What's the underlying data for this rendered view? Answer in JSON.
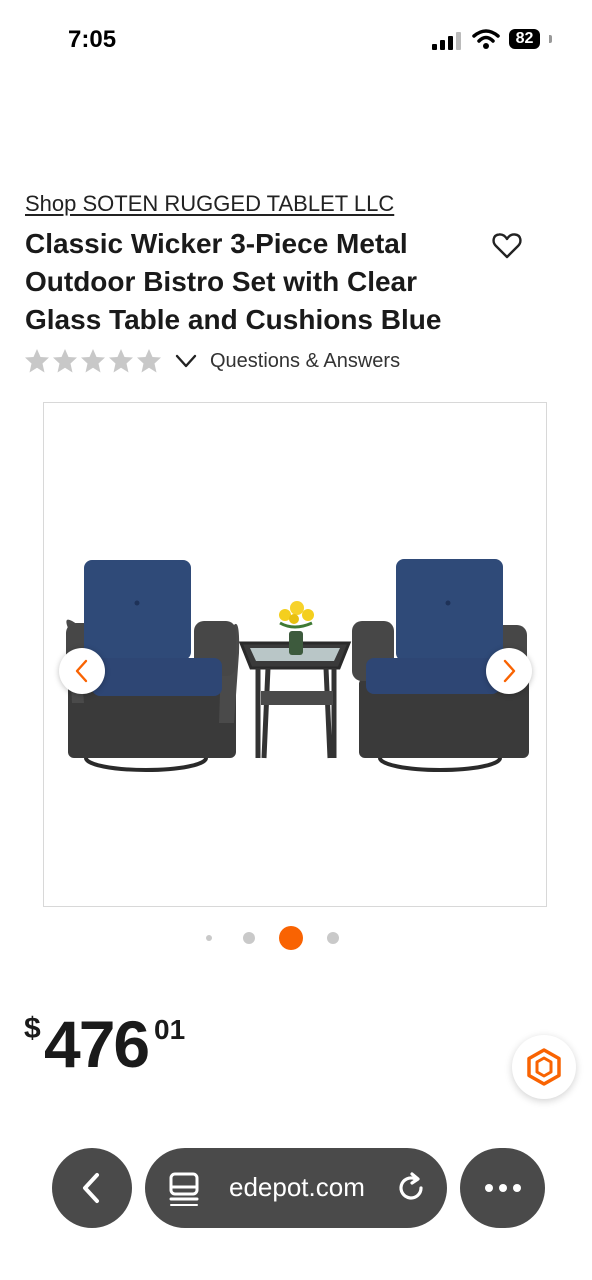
{
  "status_bar": {
    "time": "7:05",
    "battery": "82",
    "battery_level_percent": 82
  },
  "product": {
    "brand_link": "Shop SOTEN RUGGED TABLET LLC",
    "title": "Classic Wicker 3-Piece Metal Outdoor Bistro Set with Clear Glass Table and Cushions Blue",
    "rating_stars": 0,
    "rating_max": 5,
    "qa_link": "Questions & Answers"
  },
  "gallery": {
    "image_count": 4,
    "active_index": 2
  },
  "price": {
    "currency": "$",
    "dollars": "476",
    "cents": "01"
  },
  "browser": {
    "url": "edepot.com"
  },
  "colors": {
    "accent": "#f96302",
    "star": "#c8c8c8",
    "toolbar": "#4a4a4a",
    "cushion": "#2f4a78",
    "wicker": "#3a3a3a"
  },
  "icons": [
    "signal-icon",
    "wifi-icon",
    "heart-icon",
    "star-icon",
    "chevron-down-icon",
    "chevron-left-icon",
    "chevron-right-icon",
    "chat-icon",
    "back-icon",
    "reader-icon",
    "reload-icon",
    "more-icon"
  ]
}
